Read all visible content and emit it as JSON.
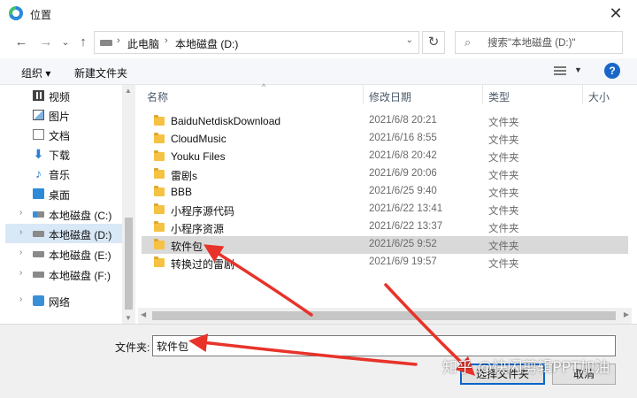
{
  "window": {
    "title": "位置",
    "close_glyph": "✕"
  },
  "nav": {
    "back_glyph": "←",
    "forward_glyph": "→",
    "history_glyph": "⌄",
    "up_glyph": "↑",
    "refresh_glyph": "↻"
  },
  "address": {
    "breadcrumbs": [
      "此电脑",
      "本地磁盘 (D:)"
    ],
    "separator": "›",
    "dropdown_glyph": "⌄"
  },
  "search": {
    "icon_glyph": "⌕",
    "placeholder": "搜索\"本地磁盘 (D:)\""
  },
  "toolbar": {
    "organize_label": "组织 ▾",
    "new_folder_label": "新建文件夹",
    "view_dropdown_glyph": "▼",
    "help_glyph": "?"
  },
  "sidebar": {
    "expander_glyph": "›",
    "items": [
      {
        "label": "视频",
        "icon": "video-icon"
      },
      {
        "label": "图片",
        "icon": "picture-icon"
      },
      {
        "label": "文档",
        "icon": "document-icon"
      },
      {
        "label": "下载",
        "icon": "download-icon",
        "icon_glyph": "⬇"
      },
      {
        "label": "音乐",
        "icon": "music-icon",
        "icon_glyph": "♪"
      },
      {
        "label": "桌面",
        "icon": "desktop-icon"
      },
      {
        "label": "本地磁盘 (C:)",
        "icon": "system-drive-icon"
      },
      {
        "label": "本地磁盘 (D:)",
        "icon": "drive-icon",
        "selected": true
      },
      {
        "label": "本地磁盘 (E:)",
        "icon": "drive-icon"
      },
      {
        "label": "本地磁盘 (F:)",
        "icon": "drive-icon"
      },
      {
        "label": "网络",
        "icon": "network-icon"
      }
    ]
  },
  "columns": {
    "name": "名称",
    "modified": "修改日期",
    "type": "类型",
    "size": "大小",
    "sort_glyph": "^"
  },
  "files": [
    {
      "name": "BaiduNetdiskDownload",
      "modified": "2021/6/8 20:21",
      "type": "文件夹"
    },
    {
      "name": "CloudMusic",
      "modified": "2021/6/16 8:55",
      "type": "文件夹"
    },
    {
      "name": "Youku Files",
      "modified": "2021/6/8 20:42",
      "type": "文件夹"
    },
    {
      "name": "雷剧s",
      "modified": "2021/6/9 20:06",
      "type": "文件夹"
    },
    {
      "name": "BBB",
      "modified": "2021/6/25 9:40",
      "type": "文件夹"
    },
    {
      "name": "小程序源代码",
      "modified": "2021/6/22 13:41",
      "type": "文件夹"
    },
    {
      "name": "小程序资源",
      "modified": "2021/6/22 13:37",
      "type": "文件夹"
    },
    {
      "name": "软件包",
      "modified": "2021/6/25 9:52",
      "type": "文件夹",
      "selected": true
    },
    {
      "name": "转换过的雷剧",
      "modified": "2021/6/9 19:57",
      "type": "文件夹"
    }
  ],
  "scroll_glyphs": {
    "up": "▲",
    "down": "▼",
    "left": "◀",
    "right": "▶"
  },
  "footer": {
    "folder_label": "文件夹:",
    "folder_value": "软件包",
    "select_button": "选择文件夹",
    "cancel_button": "取消"
  },
  "watermark": "知乎 @快闪剪辑PPT加油",
  "colors": {
    "accent": "#0a64c8",
    "arrow": "#e8332a",
    "selection": "#d9d9d9",
    "folder": "#f5c243"
  }
}
